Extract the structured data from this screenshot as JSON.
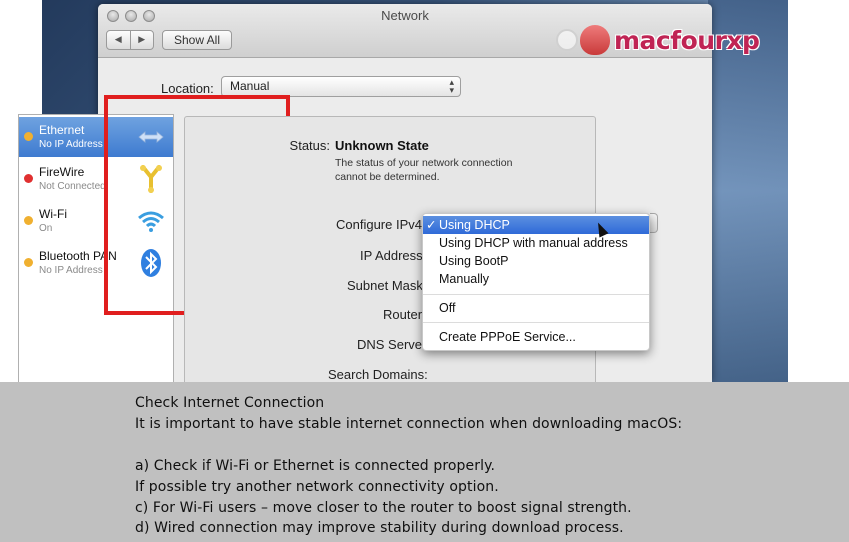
{
  "window": {
    "title": "Network",
    "show_all_label": "Show All",
    "back_glyph": "◀",
    "forward_glyph": "▶"
  },
  "watermark": {
    "text": "macfourxp"
  },
  "location": {
    "label": "Location:",
    "value": "Manual"
  },
  "services": [
    {
      "name": "Ethernet",
      "status": "No IP Address",
      "dot_color": "#f0b030",
      "icon": "ethernet-arrows-icon",
      "selected": true
    },
    {
      "name": "FireWire",
      "status": "Not Connected",
      "dot_color": "#e03030",
      "icon": "firewire-icon",
      "selected": false
    },
    {
      "name": "Wi-Fi",
      "status": "On",
      "dot_color": "#f0b030",
      "icon": "wifi-icon",
      "selected": false
    },
    {
      "name": "Bluetooth PAN",
      "status": "No IP Address",
      "dot_color": "#f0b030",
      "icon": "bluetooth-icon",
      "selected": false
    }
  ],
  "details": {
    "status_label": "Status:",
    "status_value": "Unknown State",
    "status_description": "The status of your network connection cannot be determined.",
    "configure_label": "Configure IPv4",
    "ip_label": "IP Address",
    "subnet_label": "Subnet Mask",
    "router_label": "Router",
    "dns_label": "DNS Server",
    "search_label": "Search Domains:"
  },
  "configure_menu": {
    "check_glyph": "✓",
    "items": [
      "Using DHCP",
      "Using DHCP with manual address",
      "Using BootP",
      "Manually",
      "Off",
      "Create PPPoE Service..."
    ]
  },
  "caption": {
    "title": "Check Internet Connection",
    "intro": "It is important to have stable internet connection when downloading macOS:",
    "line_a": "a) Check if Wi-Fi or Ethernet is connected properly.",
    "line_b": "If possible try another network connectivity option.",
    "line_c": "c) For Wi-Fi users – move closer to the router to boost signal strength.",
    "line_d": "d) Wired connection may improve stability during download process."
  },
  "colors": {
    "highlight_border": "#e01e1e",
    "selection_blue": "#3e7bd0",
    "watermark": "#c02454",
    "caption_bg": "#c0c0c0"
  }
}
